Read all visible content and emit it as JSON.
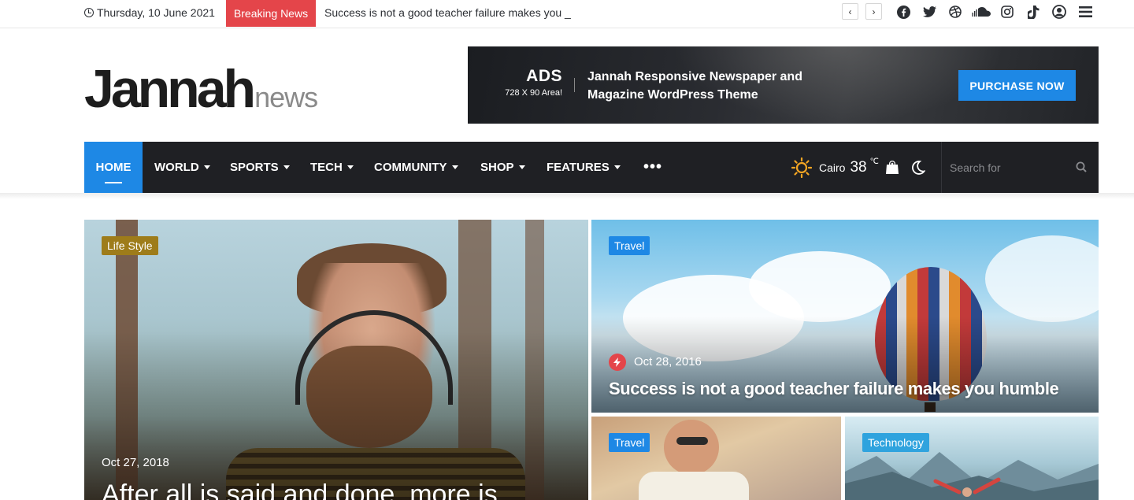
{
  "topbar": {
    "date": "Thursday, 10 June 2021",
    "breaking_label": "Breaking News",
    "breaking_text": "Success is not a good teacher failure makes you _",
    "prev_glyph": "‹",
    "next_glyph": "›",
    "social_icons": [
      "facebook-icon",
      "twitter-icon",
      "dribbble-icon",
      "soundcloud-icon",
      "instagram-icon",
      "tiktok-icon",
      "user-icon",
      "menu-icon"
    ]
  },
  "header": {
    "logo_main": "Jannah",
    "logo_sub": "news",
    "ad": {
      "title": "ADS",
      "size": "728 X 90 Area!",
      "text": "Jannah Responsive Newspaper and Magazine WordPress Theme",
      "button": "PURCHASE NOW"
    }
  },
  "nav": {
    "items": [
      {
        "label": "HOME",
        "active": true
      },
      {
        "label": "WORLD",
        "dropdown": true
      },
      {
        "label": "SPORTS",
        "dropdown": true
      },
      {
        "label": "TECH",
        "dropdown": true
      },
      {
        "label": "COMMUNITY",
        "dropdown": true
      },
      {
        "label": "SHOP",
        "dropdown": true
      },
      {
        "label": "FEATURES",
        "dropdown": true
      }
    ],
    "more": "•••",
    "weather": {
      "city": "Cairo",
      "temp": "38",
      "unit": "℃"
    },
    "search_placeholder": "Search for"
  },
  "posts": [
    {
      "category": "Life Style",
      "date": "Oct 27, 2018",
      "title": "After all is said and done, more is"
    },
    {
      "category": "Travel",
      "date": "Oct 28, 2016",
      "title": "Success is not a good teacher failure makes you humble"
    },
    {
      "category": "Travel"
    },
    {
      "category": "Technology"
    }
  ],
  "colors": {
    "accent": "#1e88e5",
    "breaking": "#e4454a",
    "nav_bg": "#1f2024",
    "lifestyle": "#9e7c1a"
  }
}
